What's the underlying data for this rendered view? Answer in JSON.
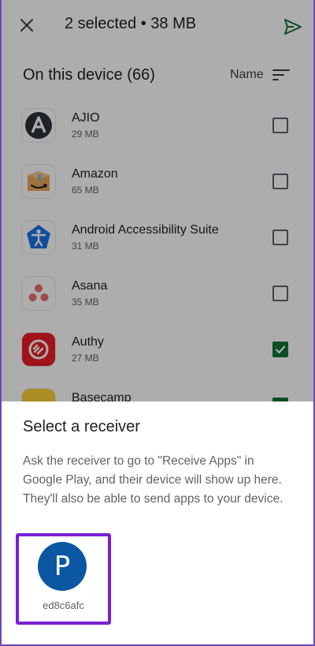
{
  "top_bar": {
    "title": "2 selected • 38 MB",
    "close_icon": "close-icon",
    "send_icon": "send-icon"
  },
  "section": {
    "title": "On this device (66)",
    "sort_label": "Name",
    "sort_icon": "sort-icon"
  },
  "apps": [
    {
      "name": "AJIO",
      "size": "29 MB",
      "icon": "ajio-app-icon",
      "checked": false
    },
    {
      "name": "Amazon",
      "size": "65 MB",
      "icon": "amazon-app-icon",
      "checked": false
    },
    {
      "name": "Android Accessibility Suite",
      "size": "31 MB",
      "icon": "accessibility-app-icon",
      "checked": false
    },
    {
      "name": "Asana",
      "size": "35 MB",
      "icon": "asana-app-icon",
      "checked": false
    },
    {
      "name": "Authy",
      "size": "27 MB",
      "icon": "authy-app-icon",
      "checked": true
    },
    {
      "name": "Basecamp",
      "size": "",
      "icon": "basecamp-app-icon",
      "checked": true
    }
  ],
  "sheet": {
    "title": "Select a receiver",
    "description": "Ask the receiver to go to \"Receive Apps\" in Google Play, and their device will show up here. They'll also be able to send apps to your device.",
    "receiver": {
      "initial": "P",
      "name": "ed8c6afc"
    }
  },
  "colors": {
    "accent_green": "#137333",
    "highlight_purple": "#7a1fd6",
    "avatar_blue": "#0b57a4"
  }
}
